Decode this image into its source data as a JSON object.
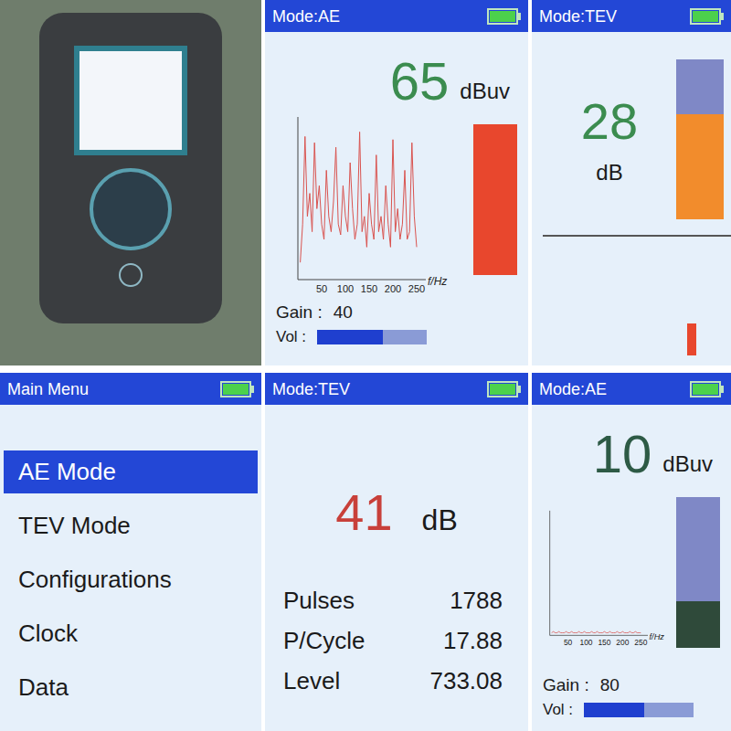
{
  "screens": [
    {
      "kind": "ae",
      "title": "Mode:AE",
      "battery": 1,
      "reading": "65",
      "unit": "dBuv",
      "color": "#3b8c4f",
      "chart": {
        "ticks": [
          "50",
          "100",
          "150",
          "200",
          "250"
        ],
        "axis_label": "f/Hz",
        "color": "#d9534f",
        "values": [
          10,
          35,
          92,
          40,
          55,
          30,
          88,
          45,
          60,
          35,
          25,
          70,
          40,
          30,
          50,
          85,
          35,
          28,
          60,
          40,
          30,
          75,
          45,
          25,
          35,
          95,
          30,
          40,
          20,
          55,
          35,
          25,
          80,
          30,
          40,
          25,
          60,
          35,
          20,
          90,
          30,
          45,
          25,
          35,
          70,
          25,
          30,
          88,
          40,
          20
        ]
      },
      "meter": {
        "level": 1,
        "color": "#e8472d"
      },
      "gain_label": "Gain :",
      "gain": "40",
      "vol_label": "Vol :",
      "vol_level": 0.6
    },
    {
      "kind": "tev-meter",
      "title": "Mode:TEV",
      "battery": 1,
      "reading": "28",
      "unit": "dB",
      "color": "#3b8c4f",
      "meter": {
        "level": 0.66,
        "color": "#f28c2c"
      },
      "pulse": {
        "level": 0.25,
        "color": "#e8472d"
      }
    },
    {
      "kind": "menu",
      "title": "Main Menu",
      "battery": 1,
      "items": [
        {
          "label": "AE Mode",
          "selected": true
        },
        {
          "label": "TEV Mode",
          "selected": false
        },
        {
          "label": "Configurations",
          "selected": false
        },
        {
          "label": "Clock",
          "selected": false
        },
        {
          "label": "Data",
          "selected": false
        }
      ]
    },
    {
      "kind": "tev-stats",
      "title": "Mode:TEV",
      "battery": 1,
      "reading": "41",
      "unit": "dB",
      "color": "#c8403a",
      "stats": [
        {
          "label": "Pulses",
          "value": "1788"
        },
        {
          "label": "P/Cycle",
          "value": "17.88"
        },
        {
          "label": "Level",
          "value": "733.08"
        }
      ]
    },
    {
      "kind": "ae",
      "title": "Mode:AE",
      "battery": 1,
      "reading": "10",
      "unit": "dBuv",
      "color": "#2d5a45",
      "chart": {
        "ticks": [
          "50",
          "100",
          "150",
          "200",
          "250"
        ],
        "axis_label": "f/Hz",
        "color": "#d9534f",
        "values": [
          1,
          2,
          1,
          1,
          2,
          1,
          1,
          1,
          2,
          1,
          1,
          2,
          1,
          1,
          1,
          2,
          1,
          1,
          2,
          1,
          1,
          1,
          2,
          1,
          1,
          2,
          1,
          1,
          1,
          2,
          1,
          1,
          2,
          1,
          1,
          1,
          2,
          1,
          1,
          2,
          1,
          1,
          1,
          2,
          1,
          1,
          2,
          1,
          1,
          1
        ]
      },
      "meter": {
        "level": 0.31,
        "color": "#2f4a3a"
      },
      "gain_label": "Gain :",
      "gain": "80",
      "vol_label": "Vol :",
      "vol_level": 0.55
    }
  ]
}
